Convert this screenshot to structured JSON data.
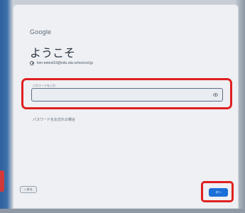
{
  "logo": {
    "text": "Google"
  },
  "heading": {
    "title": "ようこそ"
  },
  "account": {
    "email": "tion-eetest19@edu.ota-school.ed.jp"
  },
  "password_field": {
    "label": "パスワードを入力",
    "value": "",
    "visibility_icon": "eye-icon"
  },
  "links": {
    "forgot_password": "パスワードをお忘れの場合"
  },
  "buttons": {
    "back_label": "< 戻る",
    "next_label": "次へ"
  },
  "colors": {
    "highlight": "#e02020",
    "primary_button": "#1a6fd8"
  }
}
